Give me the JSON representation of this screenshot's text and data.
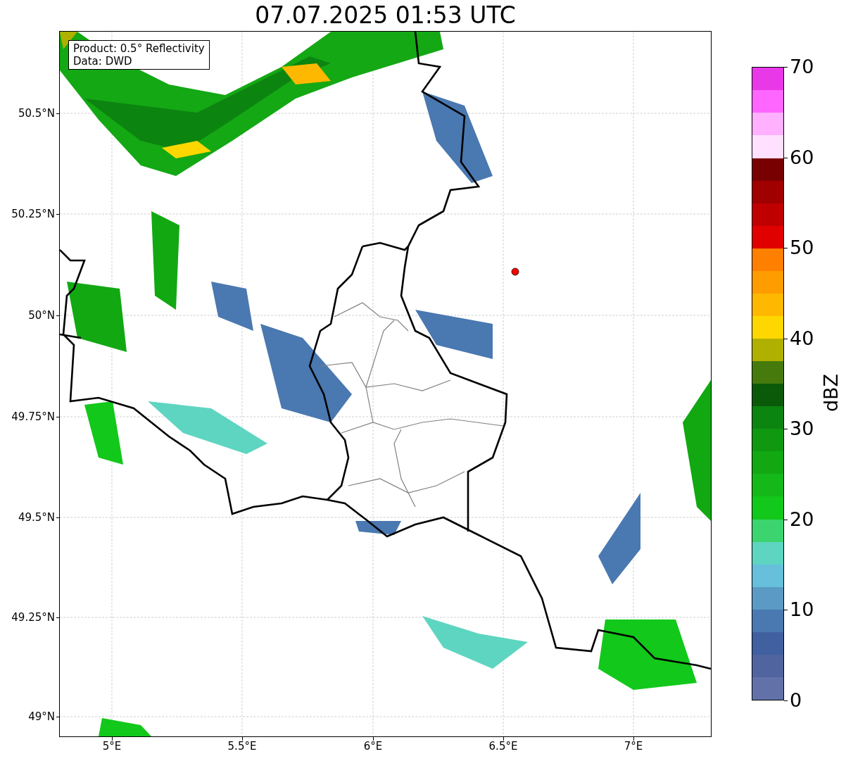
{
  "title": "07.07.2025 01:53 UTC",
  "info_box": {
    "product": "Product: 0.5° Reflectivity",
    "source": "Data: DWD"
  },
  "map": {
    "y_ticks": [
      "50.5°N",
      "50.25°N",
      "50°N",
      "49.75°N",
      "49.5°N",
      "49.25°N",
      "49°N"
    ],
    "x_ticks": [
      "5°E",
      "5.5°E",
      "6°E",
      "6.5°E",
      "7°E"
    ]
  },
  "colorbar": {
    "label": "dBZ",
    "ticks": [
      "70",
      "60",
      "50",
      "40",
      "30",
      "20",
      "10",
      "0"
    ],
    "bands": [
      {
        "color": "#6272a8"
      },
      {
        "color": "#50649f"
      },
      {
        "color": "#4060a0"
      },
      {
        "color": "#4a78b0"
      },
      {
        "color": "#5a9ac4"
      },
      {
        "color": "#66c0dc"
      },
      {
        "color": "#5ed5c0"
      },
      {
        "color": "#3cd46e"
      },
      {
        "color": "#12c81a"
      },
      {
        "color": "#14b818"
      },
      {
        "color": "#12a812"
      },
      {
        "color": "#0f9810"
      },
      {
        "color": "#0c8410"
      },
      {
        "color": "#0a5a0a"
      },
      {
        "color": "#467a0c"
      },
      {
        "color": "#b0b000"
      },
      {
        "color": "#ffd700"
      },
      {
        "color": "#ffb800"
      },
      {
        "color": "#ff9c00"
      },
      {
        "color": "#ff7f00"
      },
      {
        "color": "#e00000"
      },
      {
        "color": "#c00000"
      },
      {
        "color": "#a00000"
      },
      {
        "color": "#780000"
      },
      {
        "color": "#ffe0ff"
      },
      {
        "color": "#ffb0ff"
      },
      {
        "color": "#ff66ff"
      },
      {
        "color": "#e838e8"
      }
    ]
  }
}
